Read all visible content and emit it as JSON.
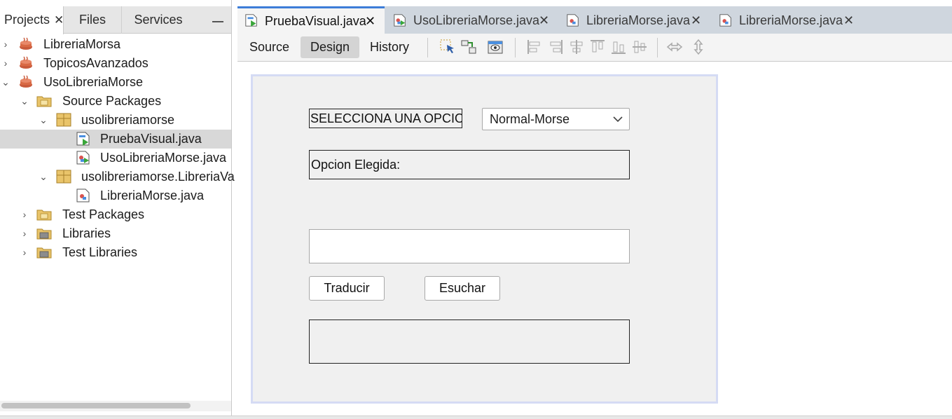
{
  "left_panel": {
    "tabs": [
      {
        "label": "Projects",
        "active": true
      },
      {
        "label": "Files",
        "active": false
      },
      {
        "label": "Services",
        "active": false
      }
    ],
    "tree": [
      {
        "label": "LibreriaMorsa",
        "depth": 0,
        "expanded": false,
        "icon": "java-project-icon"
      },
      {
        "label": "TopicosAvanzados",
        "depth": 0,
        "expanded": false,
        "icon": "java-project-icon"
      },
      {
        "label": "UsoLibreriaMorse",
        "depth": 0,
        "expanded": true,
        "icon": "java-project-icon"
      },
      {
        "label": "Source Packages",
        "depth": 1,
        "expanded": true,
        "icon": "folder-icon"
      },
      {
        "label": "usolibreriamorse",
        "depth": 2,
        "expanded": true,
        "icon": "package-icon"
      },
      {
        "label": "PruebaVisual.java",
        "depth": 3,
        "selected": true,
        "icon": "form-file-icon"
      },
      {
        "label": "UsoLibreriaMorse.java",
        "depth": 3,
        "icon": "main-class-icon"
      },
      {
        "label": "usolibreriamorse.LibreriaVa",
        "depth": 2,
        "expanded": true,
        "icon": "package-icon"
      },
      {
        "label": "LibreriaMorse.java",
        "depth": 3,
        "icon": "java-file-icon"
      },
      {
        "label": "Test Packages",
        "depth": 1,
        "expanded": false,
        "icon": "folder-icon"
      },
      {
        "label": "Libraries",
        "depth": 1,
        "expanded": false,
        "icon": "library-icon"
      },
      {
        "label": "Test Libraries",
        "depth": 1,
        "expanded": false,
        "icon": "library-icon"
      }
    ]
  },
  "editor": {
    "tabs": [
      {
        "label": "PruebaVisual.java",
        "active": true,
        "icon": "form-file-icon"
      },
      {
        "label": "UsoLibreriaMorse.java",
        "active": false,
        "icon": "main-class-icon"
      },
      {
        "label": "LibreriaMorse.java",
        "active": false,
        "icon": "java-file-icon"
      },
      {
        "label": "LibreriaMorse.java",
        "active": false,
        "icon": "java-file-icon"
      }
    ],
    "view_tabs": [
      {
        "label": "Source",
        "active": false
      },
      {
        "label": "Design",
        "active": true
      },
      {
        "label": "History",
        "active": false
      }
    ]
  },
  "form": {
    "select_label": "SELECCIONA UNA OPCION",
    "combo_value": "Normal-Morse",
    "chosen_label": "Opcion Elegida:",
    "input_value": "",
    "translate_button": "Traducir",
    "listen_button": "Esuchar",
    "output_value": ""
  },
  "colors": {
    "active_tab_accent": "#3d7dd8",
    "form_border": "#d5dbf4",
    "selection": "#d8d8d8"
  }
}
